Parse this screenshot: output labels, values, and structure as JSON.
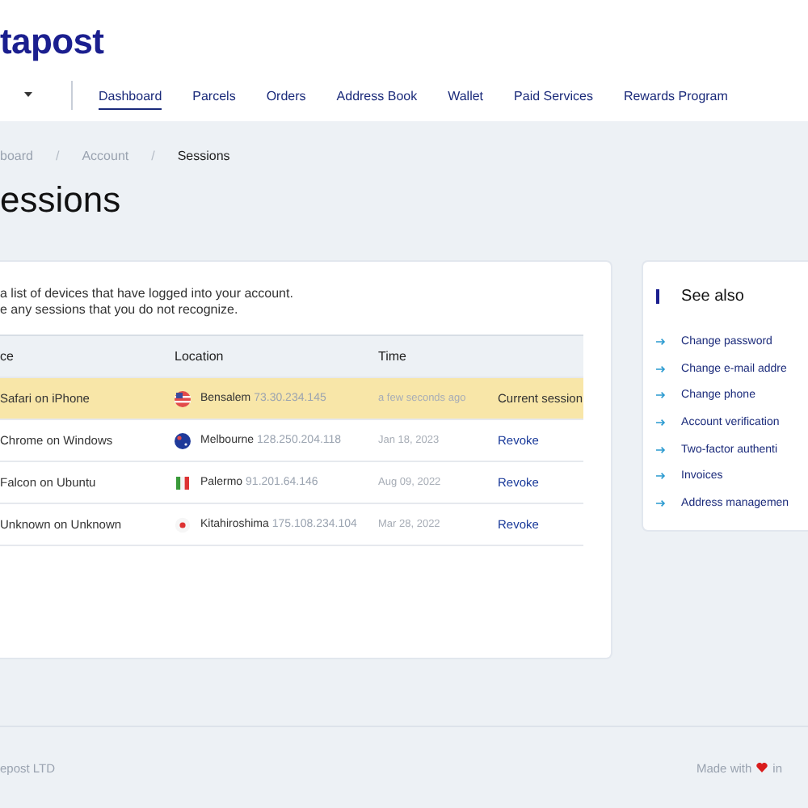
{
  "logo": "tapost",
  "nav": [
    {
      "label": "Dashboard",
      "selected": true
    },
    {
      "label": "Parcels",
      "selected": false
    },
    {
      "label": "Orders",
      "selected": false
    },
    {
      "label": "Address Book",
      "selected": false
    },
    {
      "label": "Wallet",
      "selected": false
    },
    {
      "label": "Paid Services",
      "selected": false
    },
    {
      "label": "Rewards Program",
      "selected": false
    }
  ],
  "breadcrumb": [
    {
      "label": "board",
      "current": false
    },
    {
      "label": "Account",
      "current": false
    },
    {
      "label": "Sessions",
      "current": true
    }
  ],
  "breadcrumb_separator": "/",
  "title": "essions",
  "intro": [
    "a list of devices that have logged into your account.",
    "e any sessions that you do not recognize."
  ],
  "table": {
    "columns": [
      "ce",
      "Location",
      "Time"
    ],
    "rows": [
      {
        "device": "Safari on iPhone",
        "kind": "us",
        "city": "Bensalem",
        "ip": "73.30.234.145",
        "time": "a few seconds ago",
        "action": "Current session",
        "current": true
      },
      {
        "device": "Chrome on Windows",
        "kind": "au",
        "city": "Melbourne",
        "ip": "128.250.204.118",
        "time": "Jan 18, 2023",
        "action": "Revoke",
        "current": false
      },
      {
        "device": "Falcon on Ubuntu",
        "kind": "it",
        "city": "Palermo",
        "ip": "91.201.64.146",
        "time": "Aug 09, 2022",
        "action": "Revoke",
        "current": false
      },
      {
        "device": "Unknown on Unknown",
        "kind": "jp",
        "city": "Kitahiroshima",
        "ip": "175.108.234.104",
        "time": "Mar 28, 2022",
        "action": "Revoke",
        "current": false
      }
    ]
  },
  "see_also": {
    "title": "See also",
    "links": [
      "Change password",
      "Change e-mail addre",
      "Change phone",
      "Account verification",
      "Two-factor authenti",
      "Invoices",
      "Address managemen"
    ]
  },
  "footer": {
    "left": "epost LTD",
    "made": "Made with",
    "in": "in"
  }
}
